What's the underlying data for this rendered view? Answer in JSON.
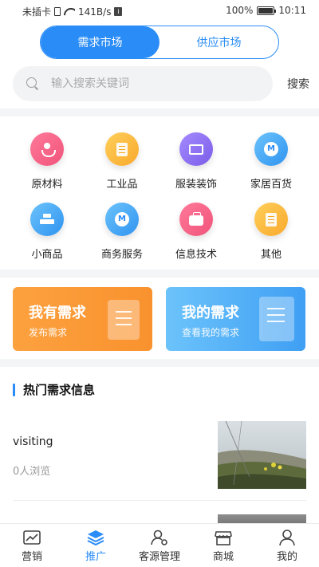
{
  "status_bar": {
    "carrier": "未插卡",
    "speed": "141B/s",
    "battery": "100%",
    "battery_level": 1.0,
    "time": "10:11"
  },
  "market_tabs": [
    {
      "label": "需求市场",
      "active": true
    },
    {
      "label": "供应市场",
      "active": false
    }
  ],
  "search": {
    "placeholder": "输入搜索关键词",
    "value": "",
    "button_label": "搜索"
  },
  "categories": [
    {
      "label": "原材料",
      "icon": "planet-hand-icon",
      "color": "#f0537a"
    },
    {
      "label": "工业品",
      "icon": "document-list-icon",
      "color": "#f8b43c"
    },
    {
      "label": "服装装饰",
      "icon": "trend-screen-icon",
      "color": "#8a6ef1"
    },
    {
      "label": "家居百货",
      "icon": "m-bulb-icon",
      "color": "#3aa3f5"
    },
    {
      "label": "小商品",
      "icon": "stack-bars-icon",
      "color": "#3a97f0"
    },
    {
      "label": "商务服务",
      "icon": "m-bulb-icon",
      "color": "#3a97f0"
    },
    {
      "label": "信息技术",
      "icon": "briefcase-icon",
      "color": "#f0537a"
    },
    {
      "label": "其他",
      "icon": "document-list-icon",
      "color": "#f8b43c"
    }
  ],
  "banners": {
    "my_demand": {
      "title": "我有需求",
      "subtitle": "发布需求",
      "color": "#f9922e"
    },
    "my_posted": {
      "title": "我的需求",
      "subtitle": "查看我的需求",
      "color": "#4aa6f5"
    }
  },
  "hot_section": {
    "title": "热门需求信息",
    "items": [
      {
        "title": "visiting",
        "views": "0人浏览"
      }
    ]
  },
  "bottom_nav": [
    {
      "label": "营销",
      "icon": "chart-icon",
      "active": false
    },
    {
      "label": "推广",
      "icon": "layers-icon",
      "active": true
    },
    {
      "label": "客源管理",
      "icon": "user-gear-icon",
      "active": false
    },
    {
      "label": "商城",
      "icon": "store-icon",
      "active": false
    },
    {
      "label": "我的",
      "icon": "person-icon",
      "active": false
    }
  ],
  "theme": {
    "accent": "#2a8cf6"
  }
}
